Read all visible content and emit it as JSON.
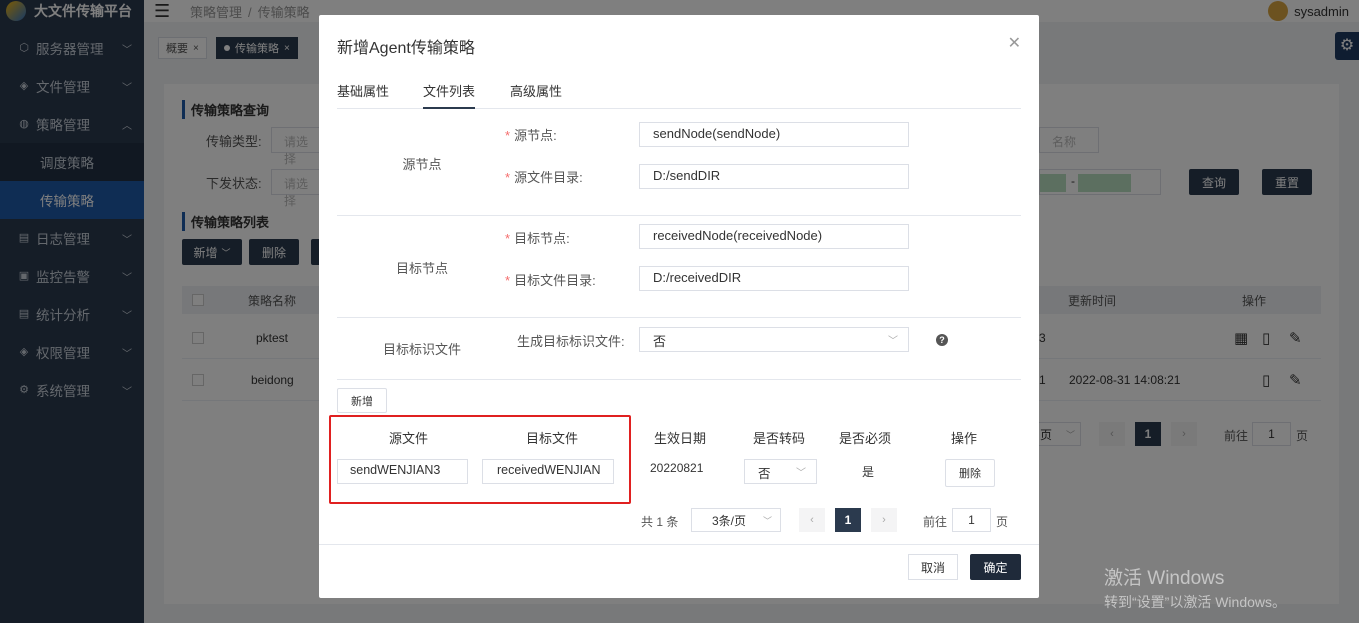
{
  "app": {
    "title": "大文件传输平台"
  },
  "sidebar": {
    "items": [
      {
        "label": "服务器管理",
        "icon": "server-icon"
      },
      {
        "label": "文件管理",
        "icon": "file-icon"
      },
      {
        "label": "策略管理",
        "icon": "policy-icon",
        "expanded": true,
        "children": [
          {
            "label": "调度策略"
          },
          {
            "label": "传输策略",
            "active": true
          }
        ]
      },
      {
        "label": "日志管理",
        "icon": "log-icon"
      },
      {
        "label": "监控告警",
        "icon": "monitor-icon"
      },
      {
        "label": "统计分析",
        "icon": "stats-icon"
      },
      {
        "label": "权限管理",
        "icon": "permission-icon"
      },
      {
        "label": "系统管理",
        "icon": "system-icon"
      }
    ]
  },
  "topbar": {
    "breadcrumb": [
      "策略管理",
      "传输策略"
    ],
    "separator": "/",
    "username": "sysadmin"
  },
  "tabs": [
    {
      "label": "概要"
    },
    {
      "label": "传输策略",
      "active": true
    }
  ],
  "background": {
    "query_title": "传输策略查询",
    "type_label": "传输类型:",
    "type_placeholder": "请选择",
    "status_label": "下发状态:",
    "status_placeholder": "请选择",
    "name_placeholder": "名称",
    "date_sep": "-",
    "search_btn": "查询",
    "reset_btn": "重置",
    "list_title": "传输策略列表",
    "add_btn": "新增",
    "delete_btn": "删除",
    "columns": {
      "name": "策略名称",
      "update_time": "更新时间",
      "ops": "操作"
    },
    "rows": [
      {
        "name": "pktest",
        "partial": "3",
        "update_time": ""
      },
      {
        "name": "beidong",
        "partial": "1",
        "update_time": "2022-08-31 14:08:21"
      }
    ],
    "pager": {
      "size_partial": "页",
      "page": "1",
      "goto": "前往",
      "goto_val": "1",
      "unit": "页"
    }
  },
  "modal": {
    "title": "新增Agent传输策略",
    "tabs": [
      "基础属性",
      "文件列表",
      "高级属性"
    ],
    "active_tab": 1,
    "source": {
      "group_label": "源节点",
      "node_label": "源节点:",
      "node_value": "sendNode(sendNode)",
      "dir_label": "源文件目录:",
      "dir_value": "D:/sendDIR"
    },
    "target": {
      "group_label": "目标节点",
      "node_label": "目标节点:",
      "node_value": "receivedNode(receivedNode)",
      "dir_label": "目标文件目录:",
      "dir_value": "D:/receivedDIR"
    },
    "flag": {
      "group_label": "目标标识文件",
      "gen_label": "生成目标标识文件:",
      "gen_value": "否"
    },
    "add_btn": "新增",
    "file_table": {
      "columns": [
        "源文件",
        "目标文件",
        "生效日期",
        "是否转码",
        "是否必须",
        "操作"
      ],
      "rows": [
        {
          "src": "sendWENJIAN3",
          "dst": "receivedWENJIAN",
          "date": "20220821",
          "transcode": "否",
          "required": "是",
          "op": "删除"
        }
      ]
    },
    "pager": {
      "total": "共 1 条",
      "size": "3条/页",
      "page": "1",
      "goto": "前往",
      "goto_val": "1",
      "unit": "页"
    },
    "cancel": "取消",
    "ok": "确定"
  },
  "watermark": {
    "line1": "激活 Windows",
    "line2": "转到“设置”以激活 Windows。"
  }
}
